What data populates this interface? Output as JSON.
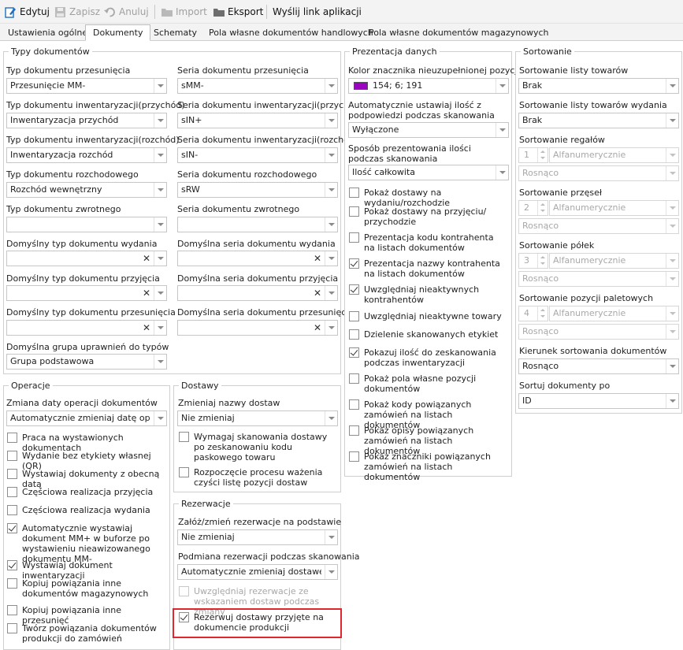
{
  "toolbar": {
    "edit": "Edytuj",
    "save": "Zapisz",
    "cancel": "Anuluj",
    "import": "Import",
    "export": "Eksport",
    "send_link": "Wyślij link aplikacji"
  },
  "tabs": [
    "Ustawienia ogólne",
    "Dokumenty",
    "Schematy",
    "Pola własne dokumentów handlowych",
    "Pola własne dokumentów magazynowych"
  ],
  "doc_types": {
    "title": "Typy dokumentów",
    "left": [
      {
        "label": "Typ dokumentu przesunięcia",
        "value": "Przesunięcie MM-"
      },
      {
        "label": "Typ dokumentu inwentaryzacji(przychód)",
        "value": "Inwentaryzacja przychód"
      },
      {
        "label": "Typ dokumentu inwentaryzacji(rozchód)",
        "value": "Inwentaryzacja rozchód"
      },
      {
        "label": "Typ dokumentu rozchodowego",
        "value": "Rozchód wewnętrzny"
      },
      {
        "label": "Typ dokumentu zwrotnego",
        "value": ""
      },
      {
        "label": "Domyślny typ dokumentu wydania",
        "value": ""
      },
      {
        "label": "Domyślny typ dokumentu przyjęcia",
        "value": ""
      },
      {
        "label": "Domyślny typ dokumentu przesunięcia",
        "value": ""
      },
      {
        "label": "Domyślna grupa uprawnień do typów",
        "value": "Grupa podstawowa"
      }
    ],
    "right": [
      {
        "label": "Seria dokumentu przesunięcia",
        "value": "sMM-"
      },
      {
        "label": "Seria dokumentu inwentaryzacji(przychód)",
        "value": "sIN+"
      },
      {
        "label": "Seria dokumentu inwentaryzacji(rozchód)",
        "value": "sIN-"
      },
      {
        "label": "Seria dokumentu rozchodowego",
        "value": "sRW"
      },
      {
        "label": "Seria dokumentu zwrotnego",
        "value": ""
      },
      {
        "label": "Domyślna seria dokumentu wydania",
        "value": ""
      },
      {
        "label": "Domyślna seria dokumentu przyjęcia",
        "value": ""
      },
      {
        "label": "Domyślna seria dokumentu przesunięcia",
        "value": ""
      }
    ]
  },
  "operations": {
    "title": "Operacje",
    "date_label": "Zmiana daty operacji dokumentów",
    "date_value": "Automatycznie zmieniaj datę operacji",
    "items": [
      {
        "text": "Praca na wystawionych dokumentach",
        "checked": false
      },
      {
        "text": "Wydanie bez etykiety własnej (QR)",
        "checked": false
      },
      {
        "text": "Wystawiaj dokumenty z obecną datą",
        "checked": false
      },
      {
        "text": "Częściowa realizacja przyjęcia",
        "checked": false
      },
      {
        "text": "Częściowa realizacja wydania",
        "checked": false
      },
      {
        "text": "Automatycznie wystawiaj dokument MM+ w buforze po wystawieniu nieawizowanego dokumentu MM-",
        "checked": true
      },
      {
        "text": "Wystawiaj dokument inwentaryzacji",
        "checked": true
      },
      {
        "text": "Kopiuj powiązania inne dokumentów magazynowych",
        "checked": false
      },
      {
        "text": "Kopiuj powiązania inne przesunięć",
        "checked": false
      },
      {
        "text": "Twórz powiązania dokumentów produkcji do zamówień",
        "checked": false
      }
    ]
  },
  "deliveries": {
    "title": "Dostawy",
    "name_label": "Zmieniaj nazwy dostaw",
    "name_value": "Nie zmieniaj",
    "items": [
      {
        "text": "Wymagaj skanowania dostawy po zeskanowaniu kodu paskowego towaru",
        "checked": false
      },
      {
        "text": "Rozpoczęcie procesu ważenia czyści listę pozycji dostaw",
        "checked": false
      }
    ]
  },
  "reservations": {
    "title": "Rezerwacje",
    "create_label": "Załóż/zmień rezerwacje na podstawie",
    "create_value": "Nie zmieniaj",
    "swap_label": "Podmiana rezerwacji podczas skanowania",
    "swap_value": "Automatycznie zmieniaj dostawę po...",
    "items": [
      {
        "text": "Uwzględniaj rezerwacje ze wskazaniem dostaw podczas zmiany",
        "checked": false,
        "disabled": true
      },
      {
        "text": "Rezerwuj dostawy przyjęte na dokumencie produkcji",
        "checked": true,
        "disabled": false
      }
    ]
  },
  "presentation": {
    "title": "Prezentacja danych",
    "color_label": "Kolor znacznika nieuzupełnionej pozycji",
    "color_value": "154; 6; 191",
    "color_hex": "#9a06bf",
    "autoqty_label": "Automatycznie ustawiaj ilość z podpowiedzi podczas skanowania",
    "autoqty_value": "Wyłączone",
    "qty_label": "Sposób prezentowania ilości podczas skanowania",
    "qty_value": "Ilość całkowita",
    "items": [
      {
        "text": "Pokaż dostawy na wydaniu/rozchodzie",
        "checked": false
      },
      {
        "text": "Pokaż dostawy na przyjęciu/ przychodzie",
        "checked": false
      },
      {
        "text": "Prezentacja kodu kontrahenta na listach dokumentów",
        "checked": false
      },
      {
        "text": "Prezentacja nazwy kontrahenta na listach dokumentów",
        "checked": true
      },
      {
        "text": "Uwzględniaj nieaktywnych kontrahentów",
        "checked": true
      },
      {
        "text": "Uwzględniaj nieaktywne towary",
        "checked": false
      },
      {
        "text": "Dzielenie skanowanych etykiet",
        "checked": false
      },
      {
        "text": "Pokazuj ilość do zeskanowania podczas inwentaryzacji",
        "checked": true
      },
      {
        "text": "Pokaż pola własne pozycji dokumentów",
        "checked": false
      },
      {
        "text": "Pokaż kody powiązanych zamówień na listach dokumentów",
        "checked": false
      },
      {
        "text": "Pokaż opisy powiązanych zamówień na listach dokumentów",
        "checked": false
      },
      {
        "text": "Pokaż znaczniki powiązanych zamówień na listach dokumentów",
        "checked": false
      }
    ]
  },
  "sorting": {
    "title": "Sortowanie",
    "goods_label": "Sortowanie listy towarów",
    "goods_value": "Brak",
    "goods_issue_label": "Sortowanie listy towarów wydania",
    "goods_issue_value": "Brak",
    "spinners": [
      {
        "label": "Sortowanie regałów",
        "num": "1",
        "mode": "Alfanumerycznie",
        "order": "Rosnąco"
      },
      {
        "label": "Sortowanie przęseł",
        "num": "2",
        "mode": "Alfanumerycznie",
        "order": "Rosnąco"
      },
      {
        "label": "Sortowanie półek",
        "num": "3",
        "mode": "Alfanumerycznie",
        "order": "Rosnąco"
      },
      {
        "label": "Sortowanie pozycji paletowych",
        "num": "4",
        "mode": "Alfanumerycznie",
        "order": "Rosnąco"
      }
    ],
    "dir_label": "Kierunek sortowania dokumentów",
    "dir_value": "Rosnąco",
    "sortby_label": "Sortuj dokumenty po",
    "sortby_value": "ID"
  }
}
